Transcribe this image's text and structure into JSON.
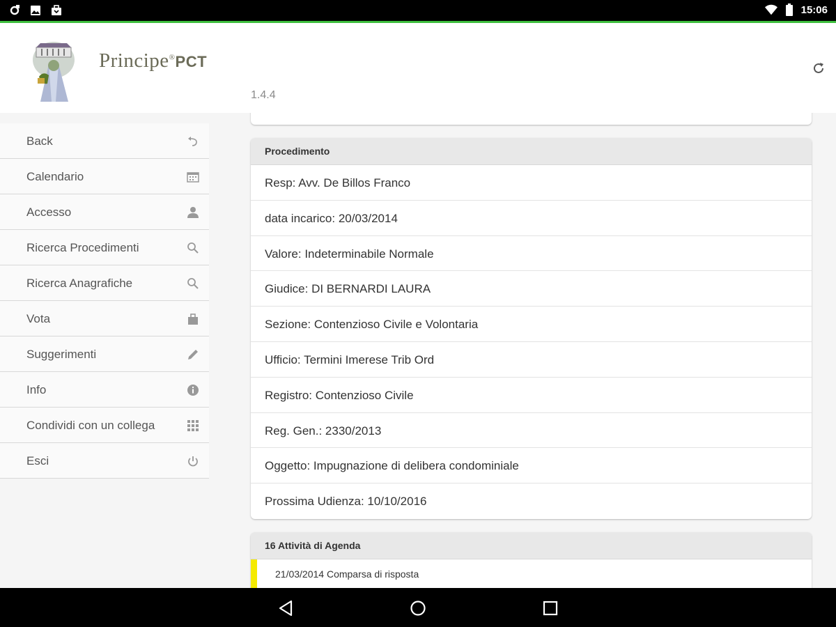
{
  "status_bar": {
    "time": "15:06",
    "left_icons": [
      "sync-icon",
      "image-icon",
      "bag-icon"
    ],
    "right_icons": [
      "wifi-icon",
      "battery-icon"
    ]
  },
  "header": {
    "brand_name": "Principe",
    "brand_reg": "®",
    "brand_suffix": "PCT",
    "version": "1.4.4",
    "refresh_icon": "refresh-icon"
  },
  "sidebar": {
    "items": [
      {
        "label": "Back",
        "icon": "undo-icon"
      },
      {
        "label": "Calendario",
        "icon": "calendar-icon"
      },
      {
        "label": "Accesso",
        "icon": "user-icon"
      },
      {
        "label": "Ricerca Procedimenti",
        "icon": "search-icon"
      },
      {
        "label": "Ricerca Anagrafiche",
        "icon": "search-icon"
      },
      {
        "label": "Vota",
        "icon": "bag-icon"
      },
      {
        "label": "Suggerimenti",
        "icon": "pencil-icon"
      },
      {
        "label": "Info",
        "icon": "info-icon"
      },
      {
        "label": "Condividi con un collega",
        "icon": "grid-icon"
      },
      {
        "label": "Esci",
        "icon": "power-icon"
      }
    ]
  },
  "procedimento": {
    "title": "Procedimento",
    "rows": [
      "Resp: Avv. De Billos Franco",
      "data incarico: 20/03/2014",
      "Valore: Indeterminabile Normale",
      "Giudice: DI BERNARDI LAURA",
      "Sezione: Contenzioso Civile e Volontaria",
      "Ufficio: Termini Imerese Trib Ord",
      "Registro: Contenzioso Civile",
      "Reg. Gen.: 2330/2013",
      "Oggetto: Impugnazione di delibera condominiale",
      "Prossima Udienza: 10/10/2016"
    ]
  },
  "agenda": {
    "title": "16 Attività di Agenda",
    "items": [
      {
        "text": "21/03/2014 Comparsa di risposta"
      }
    ],
    "accent_color": "#f5ea00"
  },
  "nav_bar": {
    "buttons": [
      "back-nav-icon",
      "home-nav-icon",
      "recents-nav-icon"
    ]
  },
  "colors": {
    "accent_green": "#3fbf3f",
    "brand_text": "#6b6b58"
  }
}
